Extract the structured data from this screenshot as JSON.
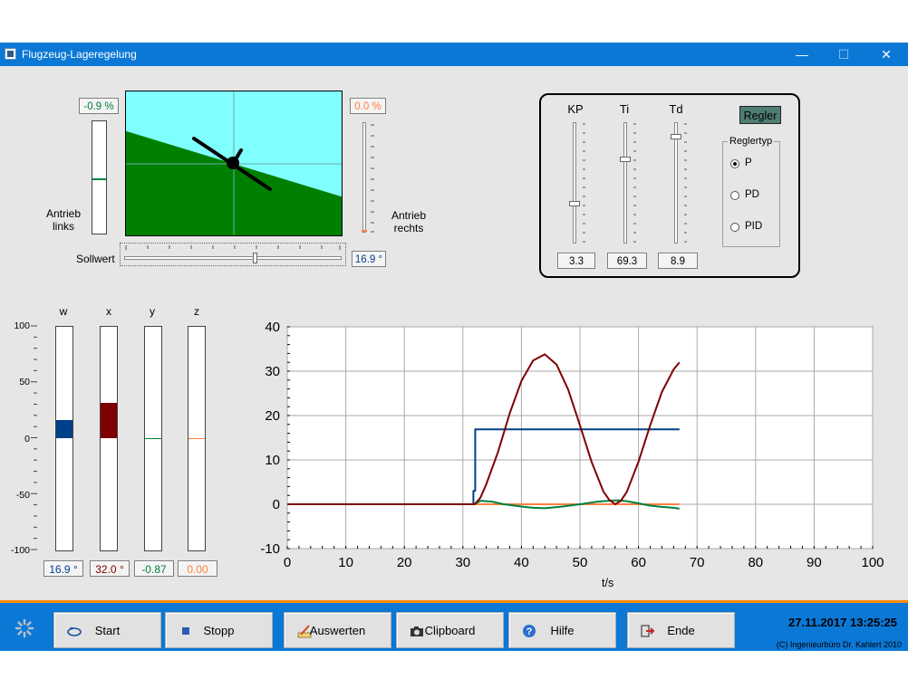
{
  "window": {
    "title": "Flugzeug-Lageregelung",
    "minimize_glyph": "—",
    "maximize_glyph": "☐",
    "close_glyph": "✕"
  },
  "attitude": {
    "left_percent": "-0.9  %",
    "right_percent": "0.0 %",
    "left_label_1": "Antrieb",
    "left_label_2": "links",
    "right_label_1": "Antrieb",
    "right_label_2": "rechts",
    "setpoint_label": "Sollwert",
    "setpoint_value": "16.9 °",
    "horizon_angle_deg": 16.9,
    "left_drive_level": -0.009,
    "right_drive_level": 0.0,
    "colors": {
      "sky": "#80ffff",
      "ground": "#008000"
    }
  },
  "controller": {
    "kp_label": "KP",
    "ti_label": "Ti",
    "td_label": "Td",
    "kp_value": "3.3",
    "ti_value": "69.3",
    "td_value": "8.9",
    "kp_pos": 0.68,
    "ti_pos": 0.3,
    "td_pos": 0.1,
    "regler_button": "Regler",
    "group_title": "Reglertyp",
    "options": [
      "P",
      "PD",
      "PID"
    ],
    "selected": "P"
  },
  "bars": {
    "labels": [
      "w",
      "x",
      "y",
      "z"
    ],
    "axis": [
      "100",
      "50",
      "0",
      "-50",
      "-100"
    ],
    "values": [
      16.9,
      32.0,
      -0.87,
      0.0
    ],
    "displays": [
      "16.9 °",
      "32.0 °",
      "-0.87",
      "0.00"
    ],
    "colors": [
      "#003f8a",
      "#7f0000",
      "#008040",
      "#ff8040"
    ]
  },
  "chart_data": {
    "type": "line",
    "xlabel": "t/s",
    "xlim": [
      0,
      100
    ],
    "ylim": [
      -10,
      40
    ],
    "xticks": [
      0,
      10,
      20,
      30,
      40,
      50,
      60,
      70,
      80,
      90,
      100
    ],
    "yticks": [
      -10,
      0,
      10,
      20,
      30,
      40
    ],
    "grid": true,
    "series": [
      {
        "color": "#ff8040",
        "x": [
          0,
          32,
          67
        ],
        "y": [
          0,
          0,
          0
        ]
      },
      {
        "color": "#003f8a",
        "x": [
          0,
          31.8,
          31.8,
          32.1,
          32.1,
          67
        ],
        "y": [
          0,
          0,
          3,
          3,
          16.9,
          16.9
        ]
      },
      {
        "color": "#008040",
        "x": [
          0,
          32,
          33,
          35,
          37,
          40,
          42,
          44,
          47,
          50,
          53,
          55,
          56.5,
          58,
          60,
          62,
          64,
          66,
          67
        ],
        "y": [
          0,
          0,
          0.8,
          0.6,
          0,
          -0.5,
          -0.8,
          -0.9,
          -0.5,
          0,
          0.6,
          0.8,
          0.9,
          0.7,
          0.2,
          -0.3,
          -0.6,
          -0.8,
          -1
        ]
      },
      {
        "color": "#7f0000",
        "x": [
          0,
          32,
          33,
          34,
          36,
          38,
          40,
          42,
          44,
          46,
          48,
          50,
          52,
          54,
          55,
          56,
          57,
          58,
          60,
          62,
          64,
          66,
          67
        ],
        "y": [
          0,
          0,
          1.5,
          4.5,
          11.8,
          20.5,
          27.8,
          32.4,
          33.8,
          31.5,
          25.8,
          17.8,
          9.5,
          2.9,
          1,
          0,
          0.8,
          2.8,
          9.6,
          17.8,
          25.3,
          30.4,
          32
        ]
      }
    ]
  },
  "footer": {
    "buttons": [
      "Start",
      "Stopp",
      "Auswerten",
      "Clipboard",
      "Hilfe",
      "Ende"
    ],
    "datetime": "27.11.2017  13:25:25",
    "copyright": "(C) Ingenieurbüro Dr. Kahlert 2010",
    "accent": "#ff8c00",
    "bg": "#0b78d6"
  }
}
